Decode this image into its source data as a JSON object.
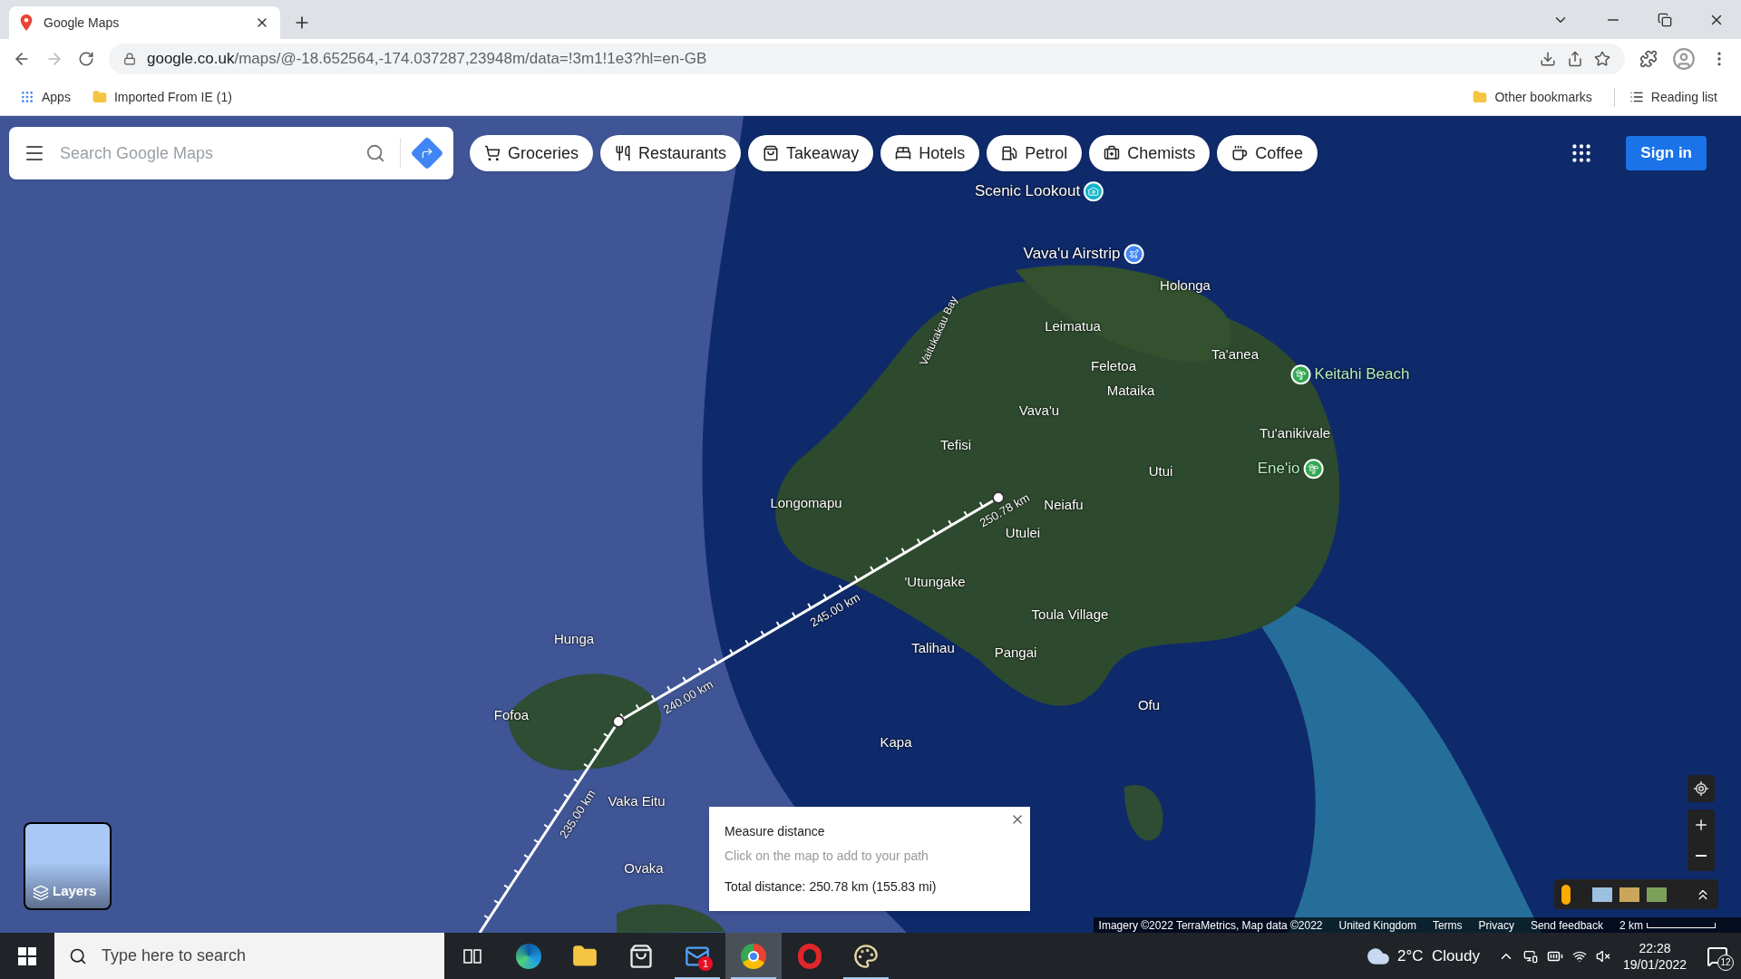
{
  "browser": {
    "tab": {
      "title": "Google Maps"
    },
    "url_host": "google.co.uk",
    "url_path": "/maps/@-18.652564,-174.037287,23948m/data=!3m1!1e3?hl=en-GB",
    "bookmarks": [
      {
        "label": "Apps",
        "kind": "apps"
      },
      {
        "label": "Imported From IE (1)",
        "kind": "folder"
      }
    ],
    "bookmarks_right": [
      {
        "label": "Other bookmarks",
        "kind": "folder"
      },
      {
        "label": "Reading list",
        "kind": "reading"
      }
    ]
  },
  "maps": {
    "search": {
      "placeholder": "Search Google Maps"
    },
    "chips": [
      {
        "label": "Groceries"
      },
      {
        "label": "Restaurants"
      },
      {
        "label": "Takeaway"
      },
      {
        "label": "Hotels"
      },
      {
        "label": "Petrol"
      },
      {
        "label": "Chemists"
      },
      {
        "label": "Coffee"
      }
    ],
    "sign_in": "Sign in",
    "places": [
      {
        "name": "Scenic Lookout",
        "kind": "poi",
        "color": "#12b5cb"
      },
      {
        "name": "Vava'u Airstrip",
        "kind": "poi",
        "color": "#4285f4"
      },
      {
        "name": "Holonga",
        "kind": "place"
      },
      {
        "name": "Vaitukakau Bay",
        "kind": "water"
      },
      {
        "name": "Leimatua",
        "kind": "place"
      },
      {
        "name": "Ta'anea",
        "kind": "place"
      },
      {
        "name": "Keitahi Beach",
        "kind": "poi",
        "color": "#34a853"
      },
      {
        "name": "Feletoa",
        "kind": "place"
      },
      {
        "name": "Mataika",
        "kind": "place"
      },
      {
        "name": "Vava'u",
        "kind": "place"
      },
      {
        "name": "Tu'anikivale",
        "kind": "place"
      },
      {
        "name": "Tefisi",
        "kind": "place"
      },
      {
        "name": "Ene'io",
        "kind": "poi",
        "color": "#34a853"
      },
      {
        "name": "Utui",
        "kind": "place"
      },
      {
        "name": "Longomapu",
        "kind": "place"
      },
      {
        "name": "Neiafu",
        "kind": "place"
      },
      {
        "name": "Utulei",
        "kind": "place"
      },
      {
        "name": "'Utungake",
        "kind": "place"
      },
      {
        "name": "Toula Village",
        "kind": "place"
      },
      {
        "name": "Hunga",
        "kind": "place"
      },
      {
        "name": "Talihau",
        "kind": "place"
      },
      {
        "name": "Pangai",
        "kind": "place"
      },
      {
        "name": "Ofu",
        "kind": "place"
      },
      {
        "name": "Fofoa",
        "kind": "place"
      },
      {
        "name": "Kapa",
        "kind": "place"
      },
      {
        "name": "Vaka Eitu",
        "kind": "place"
      },
      {
        "name": "Ovaka",
        "kind": "place"
      }
    ],
    "distance_labels": [
      "250.78 km",
      "245.00 km",
      "240.00 km",
      "235.00 km"
    ],
    "measure": {
      "title": "Measure distance",
      "hint": "Click on the map to add to your path",
      "total": "Total distance: 250.78 km (155.83 mi)"
    },
    "layers": "Layers",
    "attribution": [
      "Imagery ©2022 TerraMetrics, Map data ©2022",
      "United Kingdom",
      "Terms",
      "Privacy",
      "Send feedback"
    ],
    "scale": "2 km"
  },
  "taskbar": {
    "search_placeholder": "Type here to search",
    "apps": [
      {
        "running": false,
        "selected": false
      },
      {
        "running": false,
        "selected": false
      },
      {
        "running": false,
        "selected": false
      },
      {
        "running": false,
        "selected": false
      },
      {
        "running": true,
        "selected": false,
        "badge": "1"
      },
      {
        "running": true,
        "selected": true
      },
      {
        "running": false,
        "selected": false
      },
      {
        "running": true,
        "selected": false
      }
    ],
    "weather": "2°C  Cloudy",
    "time": "22:28",
    "date": "19/01/2022",
    "notifications": "12"
  }
}
